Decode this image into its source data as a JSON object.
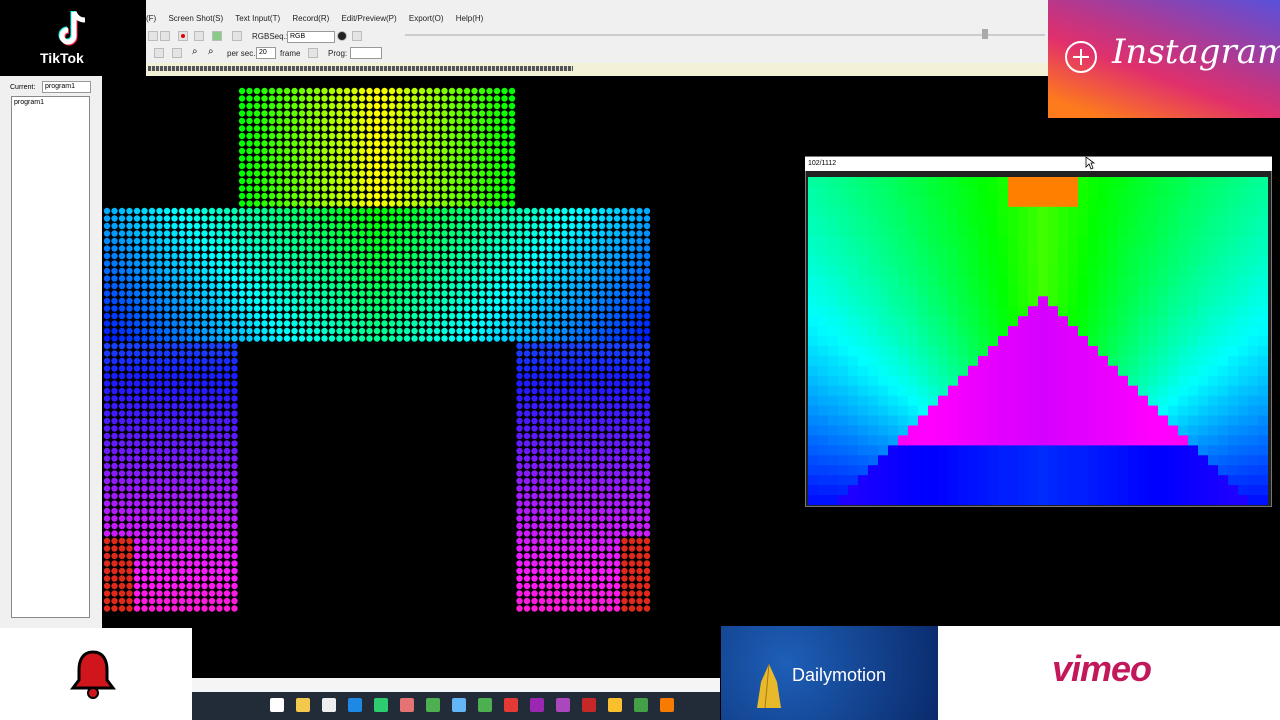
{
  "menu": [
    "(F)",
    "Screen Shot(S)",
    "Text Input(T)",
    "Record(R)",
    "Edit/Preview(P)",
    "Export(O)",
    "Help(H)"
  ],
  "toolbar": {
    "rgbseq_label": "RGBSeq.:",
    "rgbseq_value": "RGB",
    "per_sec_label": "per sec.",
    "per_sec_value": "20",
    "frame_label": "frame",
    "prog_label": "Prog:",
    "prog_value": ""
  },
  "left_panel": {
    "current_label": "Current:",
    "current_value": "program1",
    "program_items": [
      "program1"
    ]
  },
  "preview": {
    "title": "102/1112"
  },
  "overlays": {
    "tiktok": "TikTok",
    "instagram": "Instagram",
    "dailymotion": "Dailymotion",
    "vimeo": "vimeo"
  },
  "taskbar_icons": [
    "task-view-icon",
    "file-explorer-icon",
    "store-icon",
    "edge-icon",
    "edge-dev-icon",
    "app-icon",
    "colorful-app-icon",
    "app-icon-2",
    "chrome-icon",
    "ic-app-icon",
    "cube-app-icon",
    "cube-app-icon-2",
    "h-app-icon",
    "chrome-icon-2",
    "rm-app-icon",
    "app-icon-3"
  ],
  "colors": {
    "tiktok_bg": "#000000",
    "instagram_gradient": "purple-pink-orange",
    "dailymotion_bg": "#1e5fb8",
    "vimeo_text": "#c2185b"
  }
}
